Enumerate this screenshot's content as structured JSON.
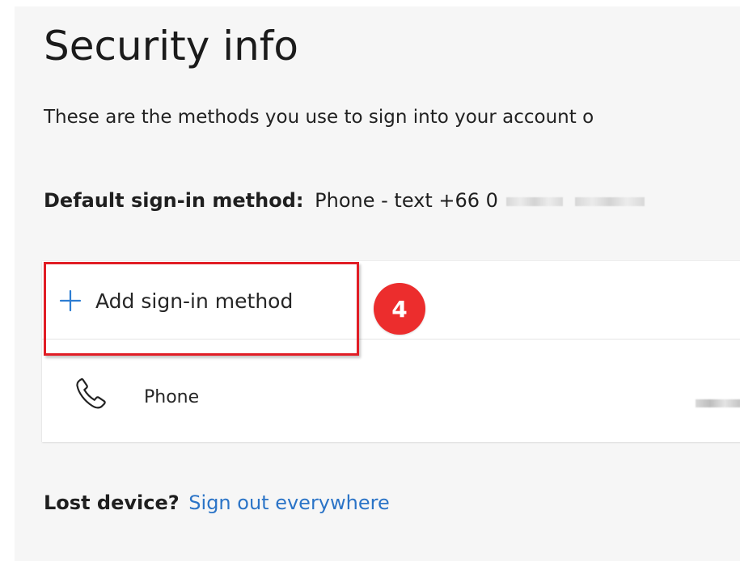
{
  "page": {
    "title": "Security info",
    "description": "These are the methods you use to sign into your account o",
    "default_method_label": "Default sign-in method:",
    "default_method_value": "Phone - text +66 0"
  },
  "actions": {
    "add_sign_in_method_label": "Add sign-in method",
    "step_number": "4"
  },
  "methods": [
    {
      "type": "Phone",
      "icon": "phone-icon"
    }
  ],
  "footer": {
    "lost_device_label": "Lost device?",
    "sign_out_link": "Sign out everywhere"
  },
  "colors": {
    "page_background": "#f6f6f6",
    "card_background": "#ffffff",
    "highlight": "#e11d25",
    "step_badge": "#ec2d2d",
    "link": "#2b74c7",
    "accent_blue": "#2d7dd2"
  }
}
